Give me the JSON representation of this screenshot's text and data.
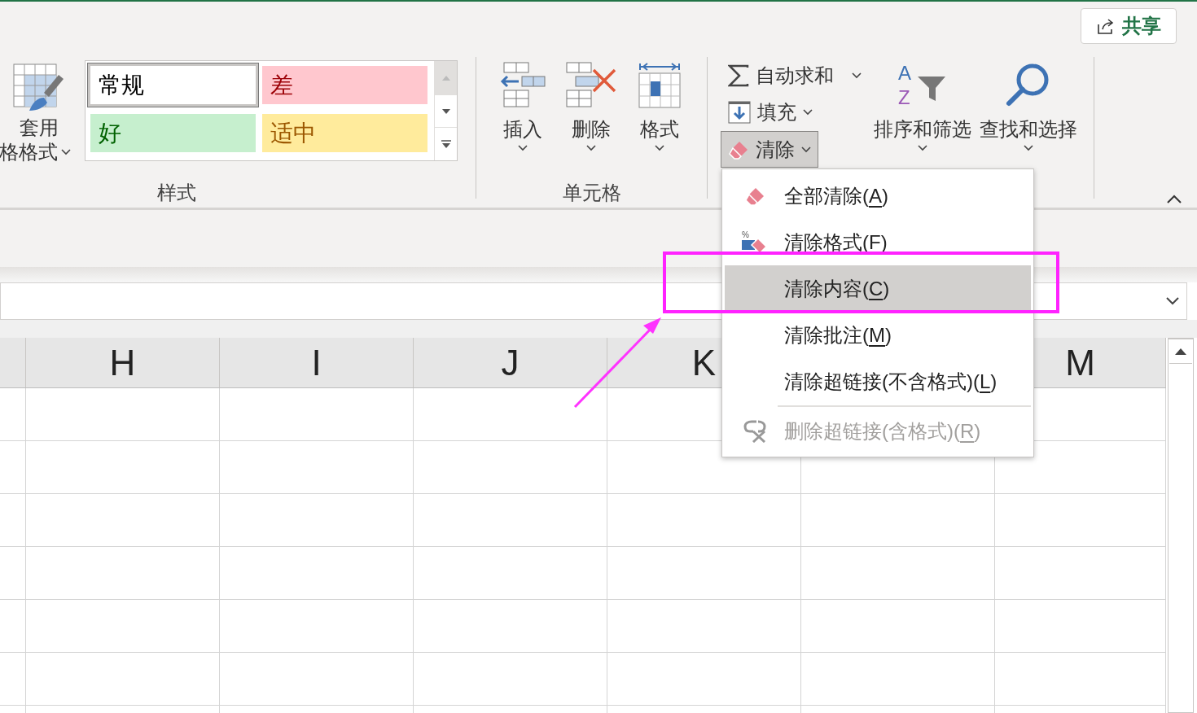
{
  "share_button": {
    "label": "共享"
  },
  "styles_group": {
    "label": "样式",
    "table_format": {
      "line1": "套用",
      "line2": "格格式"
    },
    "gallery": [
      {
        "label": "常规",
        "kind": "normal",
        "selected": true
      },
      {
        "label": "差",
        "kind": "bad",
        "selected": false
      },
      {
        "label": "好",
        "kind": "good",
        "selected": false
      },
      {
        "label": "适中",
        "kind": "neutral",
        "selected": false
      }
    ]
  },
  "cells_group": {
    "label": "单元格",
    "buttons": [
      {
        "label": "插入"
      },
      {
        "label": "删除"
      },
      {
        "label": "格式"
      }
    ]
  },
  "editing_group": {
    "small_buttons": [
      {
        "label": "自动求和",
        "pressed": false
      },
      {
        "label": "填充",
        "pressed": false
      },
      {
        "label": "清除",
        "pressed": true
      }
    ],
    "large_buttons": [
      {
        "label": "排序和筛选",
        "icon_letters": [
          "A",
          "Z"
        ]
      },
      {
        "label": "查找和选择"
      }
    ]
  },
  "clear_menu": [
    {
      "prefix": "全部清除(",
      "key": "A",
      "suffix": ")",
      "selected": false,
      "disabled": false,
      "separator_before": false
    },
    {
      "prefix": "清除格式(",
      "key": "F",
      "suffix": ")",
      "icon_text": "%",
      "selected": false,
      "disabled": false,
      "separator_before": false
    },
    {
      "prefix": "清除内容(",
      "key": "C",
      "suffix": ")",
      "selected": true,
      "disabled": false,
      "separator_before": false
    },
    {
      "prefix": "清除批注(",
      "key": "M",
      "suffix": ")",
      "selected": false,
      "disabled": false,
      "separator_before": false
    },
    {
      "prefix": "清除超链接(不含格式)(",
      "key": "L",
      "suffix": ")",
      "selected": false,
      "disabled": false,
      "separator_before": false
    },
    {
      "prefix": "删除超链接(含格式)(",
      "key": "R",
      "suffix": ")",
      "selected": false,
      "disabled": true,
      "separator_before": true
    }
  ],
  "sheet": {
    "columns": [
      {
        "label": "H"
      },
      {
        "label": "I"
      },
      {
        "label": "J"
      },
      {
        "label": "K"
      },
      {},
      {
        "label": "M"
      }
    ]
  }
}
